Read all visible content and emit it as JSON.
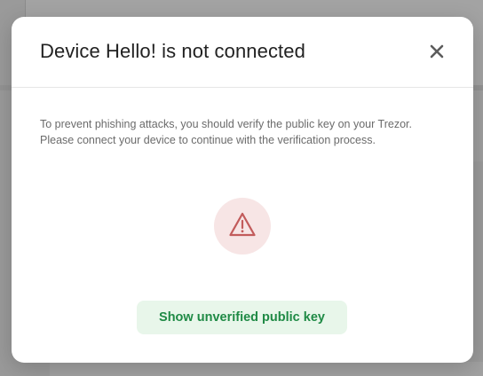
{
  "modal": {
    "title": "Device Hello! is not connected",
    "description": "To prevent phishing attacks, you should verify the public key on your Trezor. Please connect your device to continue with the verification process.",
    "status_icon": "warning-triangle-icon",
    "close_icon": "close-icon",
    "primary_button_label": "Show unverified public key"
  },
  "colors": {
    "overlay": "#9a9a9a",
    "modal_background": "#ffffff",
    "warning_icon": "#c25b5b",
    "warning_icon_background": "#f7e5e5",
    "button_text": "#1f8a45",
    "button_background": "#e8f6ea"
  }
}
